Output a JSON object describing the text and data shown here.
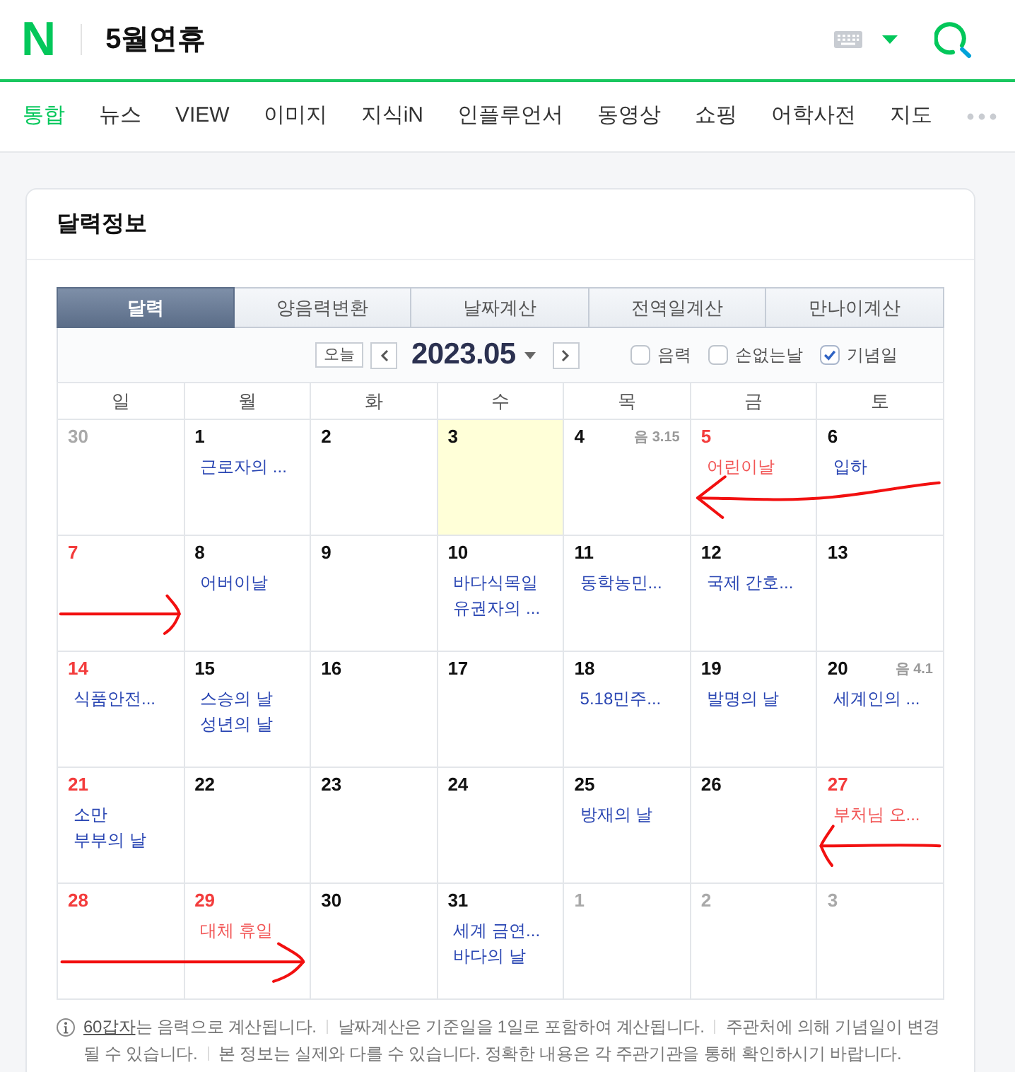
{
  "header": {
    "logo": "N",
    "query": "5월연휴"
  },
  "nav_tabs": [
    {
      "label": "통합",
      "selected": true
    },
    {
      "label": "뉴스",
      "selected": false
    },
    {
      "label": "VIEW",
      "selected": false
    },
    {
      "label": "이미지",
      "selected": false
    },
    {
      "label": "지식iN",
      "selected": false
    },
    {
      "label": "인플루언서",
      "selected": false
    },
    {
      "label": "동영상",
      "selected": false
    },
    {
      "label": "쇼핑",
      "selected": false
    },
    {
      "label": "어학사전",
      "selected": false
    },
    {
      "label": "지도",
      "selected": false
    }
  ],
  "card": {
    "title": "달력정보",
    "tabs": [
      {
        "label": "달력",
        "selected": true
      },
      {
        "label": "양음력변환",
        "selected": false
      },
      {
        "label": "날짜계산",
        "selected": false
      },
      {
        "label": "전역일계산",
        "selected": false
      },
      {
        "label": "만나이계산",
        "selected": false
      }
    ],
    "today_button": "오늘",
    "month": "2023.05",
    "options": [
      {
        "label": "음력",
        "checked": false
      },
      {
        "label": "손없는날",
        "checked": false
      },
      {
        "label": "기념일",
        "checked": true
      }
    ],
    "weekdays": [
      "일",
      "월",
      "화",
      "수",
      "목",
      "금",
      "토"
    ],
    "weeks": [
      [
        {
          "date": "30",
          "kind": "outside",
          "today": false
        },
        {
          "date": "1",
          "kind": "weekday",
          "today": false,
          "events": [
            {
              "text": "근로자의 ...",
              "holiday": false
            }
          ]
        },
        {
          "date": "2",
          "kind": "weekday",
          "today": false
        },
        {
          "date": "3",
          "kind": "weekday",
          "today": true
        },
        {
          "date": "4",
          "kind": "weekday",
          "today": false,
          "lunar": "음 3.15"
        },
        {
          "date": "5",
          "kind": "holiday",
          "today": false,
          "events": [
            {
              "text": "어린이날",
              "holiday": true
            }
          ]
        },
        {
          "date": "6",
          "kind": "weekday",
          "today": false,
          "events": [
            {
              "text": "입하",
              "holiday": false
            }
          ],
          "arrow": {
            "kind": "left-long"
          }
        }
      ],
      [
        {
          "date": "7",
          "kind": "holiday",
          "today": false,
          "arrow": {
            "kind": "right-short"
          }
        },
        {
          "date": "8",
          "kind": "weekday",
          "today": false,
          "events": [
            {
              "text": "어버이날",
              "holiday": false
            }
          ]
        },
        {
          "date": "9",
          "kind": "weekday",
          "today": false
        },
        {
          "date": "10",
          "kind": "weekday",
          "today": false,
          "events": [
            {
              "text": "바다식목일",
              "holiday": false
            },
            {
              "text": "유권자의 ...",
              "holiday": false
            }
          ]
        },
        {
          "date": "11",
          "kind": "weekday",
          "today": false,
          "events": [
            {
              "text": "동학농민...",
              "holiday": false
            }
          ]
        },
        {
          "date": "12",
          "kind": "weekday",
          "today": false,
          "events": [
            {
              "text": "국제 간호...",
              "holiday": false
            }
          ]
        },
        {
          "date": "13",
          "kind": "weekday",
          "today": false
        }
      ],
      [
        {
          "date": "14",
          "kind": "holiday",
          "today": false,
          "events": [
            {
              "text": "식품안전...",
              "holiday": false
            }
          ]
        },
        {
          "date": "15",
          "kind": "weekday",
          "today": false,
          "events": [
            {
              "text": "스승의 날",
              "holiday": false
            },
            {
              "text": "성년의 날",
              "holiday": false
            }
          ]
        },
        {
          "date": "16",
          "kind": "weekday",
          "today": false
        },
        {
          "date": "17",
          "kind": "weekday",
          "today": false
        },
        {
          "date": "18",
          "kind": "weekday",
          "today": false,
          "events": [
            {
              "text": "5.18민주...",
              "holiday": false
            }
          ]
        },
        {
          "date": "19",
          "kind": "weekday",
          "today": false,
          "events": [
            {
              "text": "발명의 날",
              "holiday": false
            }
          ]
        },
        {
          "date": "20",
          "kind": "weekday",
          "today": false,
          "lunar": "음 4.1",
          "events": [
            {
              "text": "세계인의 ...",
              "holiday": false
            }
          ]
        }
      ],
      [
        {
          "date": "21",
          "kind": "holiday",
          "today": false,
          "events": [
            {
              "text": "소만",
              "holiday": false
            },
            {
              "text": "부부의 날",
              "holiday": false
            }
          ]
        },
        {
          "date": "22",
          "kind": "weekday",
          "today": false
        },
        {
          "date": "23",
          "kind": "weekday",
          "today": false
        },
        {
          "date": "24",
          "kind": "weekday",
          "today": false
        },
        {
          "date": "25",
          "kind": "weekday",
          "today": false,
          "events": [
            {
              "text": "방재의 날",
              "holiday": false
            }
          ]
        },
        {
          "date": "26",
          "kind": "weekday",
          "today": false
        },
        {
          "date": "27",
          "kind": "holiday",
          "today": false,
          "events": [
            {
              "text": "부처님 오...",
              "holiday": true
            }
          ],
          "arrow": {
            "kind": "left-short"
          }
        }
      ],
      [
        {
          "date": "28",
          "kind": "holiday",
          "today": false,
          "arrow": {
            "kind": "right-long"
          }
        },
        {
          "date": "29",
          "kind": "holiday",
          "today": false,
          "events": [
            {
              "text": "대체 휴일",
              "holiday": true
            }
          ]
        },
        {
          "date": "30",
          "kind": "weekday",
          "today": false
        },
        {
          "date": "31",
          "kind": "weekday",
          "today": false,
          "events": [
            {
              "text": "세계 금연...",
              "holiday": false
            },
            {
              "text": "바다의 날",
              "holiday": false
            }
          ]
        },
        {
          "date": "1",
          "kind": "outside",
          "today": false
        },
        {
          "date": "2",
          "kind": "outside",
          "today": false
        },
        {
          "date": "3",
          "kind": "outside",
          "today": false
        }
      ]
    ],
    "notes": [
      {
        "link": "60갑자",
        "text": "는 음력으로 계산됩니다."
      },
      {
        "text": "날짜계산은 기준일을 1일로 포함하여 계산됩니다."
      },
      {
        "text": "주관처에 의해 기념일이 변경될 수 있습니다."
      },
      {
        "text": "본 정보는 실제와 다를 수 있습니다. 정확한 내용은 각 주관기관을 통해 확인하시기 바랍니다."
      }
    ]
  }
}
